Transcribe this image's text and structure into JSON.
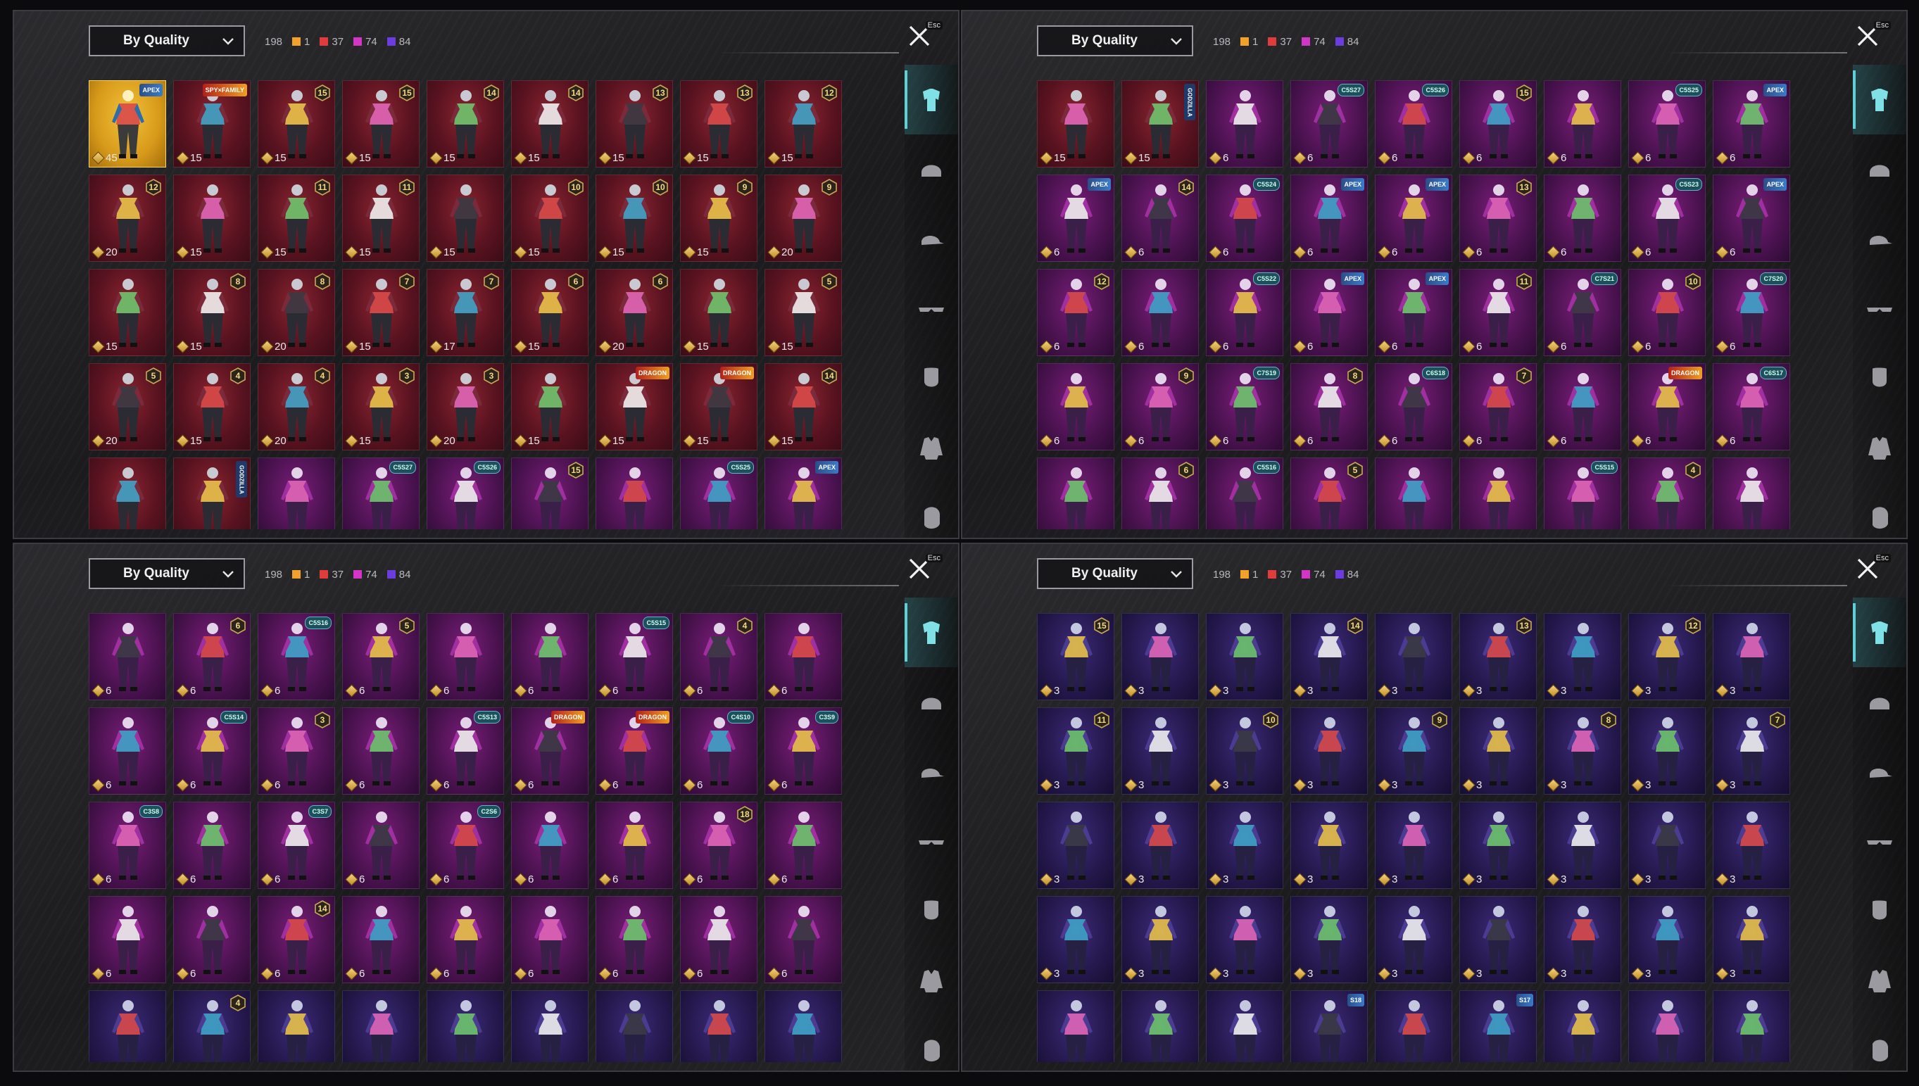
{
  "panels": [
    {
      "sort_label": "By Quality",
      "total": "198",
      "counts": [
        {
          "color": "#f2a22a",
          "value": "1"
        },
        {
          "color": "#e23b3b",
          "value": "37"
        },
        {
          "color": "#d336c6",
          "value": "74"
        },
        {
          "color": "#6b3ce0",
          "value": "84"
        }
      ],
      "close_esc": "Esc",
      "items": [
        {
          "q": "gold",
          "price": "45",
          "tag": "APEX",
          "tag_kind": "badge"
        },
        {
          "q": "red",
          "price": "15",
          "tag": "SPY×FAMILY",
          "tag_kind": "event"
        },
        {
          "q": "red",
          "price": "15",
          "level": "15"
        },
        {
          "q": "red",
          "price": "15",
          "level": "15"
        },
        {
          "q": "red",
          "price": "15",
          "level": "14"
        },
        {
          "q": "red",
          "price": "15",
          "level": "14"
        },
        {
          "q": "red",
          "price": "15",
          "level": "13"
        },
        {
          "q": "red",
          "price": "15",
          "level": "13"
        },
        {
          "q": "red",
          "price": "15",
          "level": "12"
        },
        {
          "q": "red",
          "price": "20",
          "level": "12"
        },
        {
          "q": "red",
          "price": "15"
        },
        {
          "q": "red",
          "price": "15",
          "level": "11"
        },
        {
          "q": "red",
          "price": "15",
          "level": "11"
        },
        {
          "q": "red",
          "price": "15"
        },
        {
          "q": "red",
          "price": "15",
          "level": "10"
        },
        {
          "q": "red",
          "price": "15",
          "level": "10"
        },
        {
          "q": "red",
          "price": "15",
          "level": "9"
        },
        {
          "q": "red",
          "price": "20",
          "level": "9"
        },
        {
          "q": "red",
          "price": "15"
        },
        {
          "q": "red",
          "price": "15",
          "level": "8"
        },
        {
          "q": "red",
          "price": "20",
          "level": "8"
        },
        {
          "q": "red",
          "price": "15",
          "level": "7"
        },
        {
          "q": "red",
          "price": "17",
          "level": "7"
        },
        {
          "q": "red",
          "price": "15",
          "level": "6"
        },
        {
          "q": "red",
          "price": "20",
          "level": "6"
        },
        {
          "q": "red",
          "price": "15"
        },
        {
          "q": "red",
          "price": "15",
          "level": "5"
        },
        {
          "q": "red",
          "price": "20",
          "level": "5"
        },
        {
          "q": "red",
          "price": "15",
          "level": "4"
        },
        {
          "q": "red",
          "price": "20",
          "level": "4"
        },
        {
          "q": "red",
          "price": "15",
          "level": "3"
        },
        {
          "q": "red",
          "price": "20",
          "level": "3"
        },
        {
          "q": "red",
          "price": "15"
        },
        {
          "q": "red",
          "price": "15",
          "tag": "DRAGON",
          "tag_kind": "event"
        },
        {
          "q": "red",
          "price": "15",
          "tag": "DRAGON",
          "tag_kind": "event"
        },
        {
          "q": "red",
          "price": "15",
          "level": "14"
        },
        {
          "q": "red"
        },
        {
          "q": "red",
          "tag": "GODZILLA",
          "tag_kind": "vert"
        },
        {
          "q": "pink"
        },
        {
          "q": "pink",
          "tag": "C5S27",
          "tag_kind": "season"
        },
        {
          "q": "pink",
          "tag": "C5S26",
          "tag_kind": "season"
        },
        {
          "q": "pink",
          "level": "15"
        },
        {
          "q": "pink"
        },
        {
          "q": "pink",
          "tag": "C5S25",
          "tag_kind": "season"
        },
        {
          "q": "pink",
          "tag": "APEX",
          "tag_kind": "badge"
        }
      ]
    },
    {
      "sort_label": "By Quality",
      "total": "198",
      "counts": [
        {
          "color": "#f2a22a",
          "value": "1"
        },
        {
          "color": "#e23b3b",
          "value": "37"
        },
        {
          "color": "#d336c6",
          "value": "74"
        },
        {
          "color": "#6b3ce0",
          "value": "84"
        }
      ],
      "close_esc": "Esc",
      "items": [
        {
          "q": "red",
          "price": "15"
        },
        {
          "q": "red",
          "price": "15",
          "tag": "GODZILLA",
          "tag_kind": "vert"
        },
        {
          "q": "pink",
          "price": "6"
        },
        {
          "q": "pink",
          "price": "6",
          "tag": "C5S27",
          "tag_kind": "season"
        },
        {
          "q": "pink",
          "price": "6",
          "tag": "C5S26",
          "tag_kind": "season"
        },
        {
          "q": "pink",
          "price": "6",
          "level": "15"
        },
        {
          "q": "pink",
          "price": "6"
        },
        {
          "q": "pink",
          "price": "6",
          "tag": "C5S25",
          "tag_kind": "season"
        },
        {
          "q": "pink",
          "price": "6",
          "tag": "APEX",
          "tag_kind": "badge"
        },
        {
          "q": "pink",
          "price": "6",
          "tag": "APEX",
          "tag_kind": "badge"
        },
        {
          "q": "pink",
          "price": "6",
          "level": "14"
        },
        {
          "q": "pink",
          "price": "6",
          "tag": "C5S24",
          "tag_kind": "season"
        },
        {
          "q": "pink",
          "price": "6",
          "tag": "APEX",
          "tag_kind": "badge"
        },
        {
          "q": "pink",
          "price": "6",
          "tag": "APEX",
          "tag_kind": "badge"
        },
        {
          "q": "pink",
          "price": "6",
          "level": "13"
        },
        {
          "q": "pink",
          "price": "6"
        },
        {
          "q": "pink",
          "price": "6",
          "tag": "C5S23",
          "tag_kind": "season"
        },
        {
          "q": "pink",
          "price": "6",
          "tag": "APEX",
          "tag_kind": "badge"
        },
        {
          "q": "pink",
          "price": "6",
          "level": "12"
        },
        {
          "q": "pink",
          "price": "6"
        },
        {
          "q": "pink",
          "price": "6",
          "tag": "C5S22",
          "tag_kind": "season"
        },
        {
          "q": "pink",
          "price": "6",
          "tag": "APEX",
          "tag_kind": "badge"
        },
        {
          "q": "pink",
          "price": "6",
          "tag": "APEX",
          "tag_kind": "badge"
        },
        {
          "q": "pink",
          "price": "6",
          "level": "11"
        },
        {
          "q": "pink",
          "price": "6",
          "tag": "C7S21",
          "tag_kind": "season"
        },
        {
          "q": "pink",
          "price": "6",
          "level": "10"
        },
        {
          "q": "pink",
          "price": "6",
          "tag": "C7S20",
          "tag_kind": "season"
        },
        {
          "q": "pink",
          "price": "6"
        },
        {
          "q": "pink",
          "price": "6",
          "level": "9"
        },
        {
          "q": "pink",
          "price": "6",
          "tag": "C7S19",
          "tag_kind": "season"
        },
        {
          "q": "pink",
          "price": "6",
          "level": "8"
        },
        {
          "q": "pink",
          "price": "6",
          "tag": "C6S18",
          "tag_kind": "season"
        },
        {
          "q": "pink",
          "price": "6",
          "level": "7"
        },
        {
          "q": "pink",
          "price": "6"
        },
        {
          "q": "pink",
          "price": "6",
          "tag": "DRAGON",
          "tag_kind": "event"
        },
        {
          "q": "pink",
          "price": "6",
          "tag": "C6S17",
          "tag_kind": "season"
        },
        {
          "q": "pink"
        },
        {
          "q": "pink",
          "level": "6"
        },
        {
          "q": "pink",
          "tag": "C5S16",
          "tag_kind": "season"
        },
        {
          "q": "pink",
          "level": "5"
        },
        {
          "q": "pink"
        },
        {
          "q": "pink"
        },
        {
          "q": "pink",
          "tag": "C5S15",
          "tag_kind": "season"
        },
        {
          "q": "pink",
          "level": "4"
        },
        {
          "q": "pink"
        }
      ]
    },
    {
      "sort_label": "By Quality",
      "total": "198",
      "counts": [
        {
          "color": "#f2a22a",
          "value": "1"
        },
        {
          "color": "#e23b3b",
          "value": "37"
        },
        {
          "color": "#d336c6",
          "value": "74"
        },
        {
          "color": "#6b3ce0",
          "value": "84"
        }
      ],
      "close_esc": "Esc",
      "items": [
        {
          "q": "pink",
          "price": "6"
        },
        {
          "q": "pink",
          "price": "6",
          "level": "6"
        },
        {
          "q": "pink",
          "price": "6",
          "tag": "C5S16",
          "tag_kind": "season"
        },
        {
          "q": "pink",
          "price": "6",
          "level": "5"
        },
        {
          "q": "pink",
          "price": "6"
        },
        {
          "q": "pink",
          "price": "6"
        },
        {
          "q": "pink",
          "price": "6",
          "tag": "C5S15",
          "tag_kind": "season"
        },
        {
          "q": "pink",
          "price": "6",
          "level": "4"
        },
        {
          "q": "pink",
          "price": "6"
        },
        {
          "q": "pink",
          "price": "6"
        },
        {
          "q": "pink",
          "price": "6",
          "tag": "C5S14",
          "tag_kind": "season"
        },
        {
          "q": "pink",
          "price": "6",
          "level": "3"
        },
        {
          "q": "pink",
          "price": "6"
        },
        {
          "q": "pink",
          "price": "6",
          "tag": "C5S13",
          "tag_kind": "season"
        },
        {
          "q": "pink",
          "price": "6",
          "tag": "DRAGON",
          "tag_kind": "event"
        },
        {
          "q": "pink",
          "price": "6",
          "tag": "DRAGON",
          "tag_kind": "event"
        },
        {
          "q": "pink",
          "price": "6",
          "tag": "C4S10",
          "tag_kind": "season"
        },
        {
          "q": "pink",
          "price": "6",
          "tag": "C3S9",
          "tag_kind": "season"
        },
        {
          "q": "pink",
          "price": "6",
          "tag": "C3S8",
          "tag_kind": "season"
        },
        {
          "q": "pink",
          "price": "6"
        },
        {
          "q": "pink",
          "price": "6",
          "tag": "C3S7",
          "tag_kind": "season"
        },
        {
          "q": "pink",
          "price": "6"
        },
        {
          "q": "pink",
          "price": "6",
          "tag": "C2S6",
          "tag_kind": "season"
        },
        {
          "q": "pink",
          "price": "6"
        },
        {
          "q": "pink",
          "price": "6"
        },
        {
          "q": "pink",
          "price": "6",
          "level": "18"
        },
        {
          "q": "pink",
          "price": "6"
        },
        {
          "q": "pink",
          "price": "6"
        },
        {
          "q": "pink",
          "price": "6"
        },
        {
          "q": "pink",
          "price": "6",
          "level": "14"
        },
        {
          "q": "pink",
          "price": "6"
        },
        {
          "q": "pink",
          "price": "6"
        },
        {
          "q": "pink",
          "price": "6"
        },
        {
          "q": "pink",
          "price": "6"
        },
        {
          "q": "pink",
          "price": "6"
        },
        {
          "q": "pink",
          "price": "6"
        },
        {
          "q": "purple"
        },
        {
          "q": "purple",
          "level": "4"
        },
        {
          "q": "purple"
        },
        {
          "q": "purple"
        },
        {
          "q": "purple"
        },
        {
          "q": "purple"
        },
        {
          "q": "purple"
        },
        {
          "q": "purple"
        },
        {
          "q": "purple"
        }
      ]
    },
    {
      "sort_label": "By Quality",
      "total": "198",
      "counts": [
        {
          "color": "#f2a22a",
          "value": "1"
        },
        {
          "color": "#e23b3b",
          "value": "37"
        },
        {
          "color": "#d336c6",
          "value": "74"
        },
        {
          "color": "#6b3ce0",
          "value": "84"
        }
      ],
      "close_esc": "Esc",
      "items": [
        {
          "q": "purple",
          "price": "3",
          "level": "15"
        },
        {
          "q": "purple",
          "price": "3"
        },
        {
          "q": "purple",
          "price": "3"
        },
        {
          "q": "purple",
          "price": "3",
          "level": "14"
        },
        {
          "q": "purple",
          "price": "3"
        },
        {
          "q": "purple",
          "price": "3",
          "level": "13"
        },
        {
          "q": "purple",
          "price": "3"
        },
        {
          "q": "purple",
          "price": "3",
          "level": "12"
        },
        {
          "q": "purple",
          "price": "3"
        },
        {
          "q": "purple",
          "price": "3",
          "level": "11"
        },
        {
          "q": "purple",
          "price": "3"
        },
        {
          "q": "purple",
          "price": "3",
          "level": "10"
        },
        {
          "q": "purple",
          "price": "3"
        },
        {
          "q": "purple",
          "price": "3",
          "level": "9"
        },
        {
          "q": "purple",
          "price": "3"
        },
        {
          "q": "purple",
          "price": "3",
          "level": "8"
        },
        {
          "q": "purple",
          "price": "3"
        },
        {
          "q": "purple",
          "price": "3",
          "level": "7"
        },
        {
          "q": "purple",
          "price": "3"
        },
        {
          "q": "purple",
          "price": "3"
        },
        {
          "q": "purple",
          "price": "3"
        },
        {
          "q": "purple",
          "price": "3"
        },
        {
          "q": "purple",
          "price": "3"
        },
        {
          "q": "purple",
          "price": "3"
        },
        {
          "q": "purple",
          "price": "3"
        },
        {
          "q": "purple",
          "price": "3"
        },
        {
          "q": "purple",
          "price": "3"
        },
        {
          "q": "purple",
          "price": "3"
        },
        {
          "q": "purple",
          "price": "3"
        },
        {
          "q": "purple",
          "price": "3"
        },
        {
          "q": "purple",
          "price": "3"
        },
        {
          "q": "purple",
          "price": "3"
        },
        {
          "q": "purple",
          "price": "3"
        },
        {
          "q": "purple",
          "price": "3"
        },
        {
          "q": "purple",
          "price": "3"
        },
        {
          "q": "purple",
          "price": "3"
        },
        {
          "q": "purple"
        },
        {
          "q": "purple"
        },
        {
          "q": "purple"
        },
        {
          "q": "purple",
          "tag": "S18",
          "tag_kind": "badge"
        },
        {
          "q": "purple"
        },
        {
          "q": "purple",
          "tag": "S17",
          "tag_kind": "badge"
        },
        {
          "q": "purple"
        },
        {
          "q": "purple"
        },
        {
          "q": "purple"
        }
      ]
    }
  ],
  "sidebar_icons": [
    "outfit-icon",
    "helmet-icon",
    "cap-icon",
    "glasses-icon",
    "mask-icon",
    "jacket-icon",
    "face-icon"
  ],
  "active_sidebar": "outfit-icon"
}
